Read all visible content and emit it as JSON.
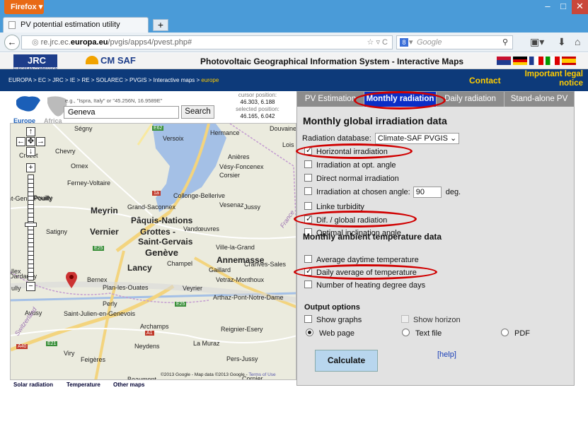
{
  "browser": {
    "firefox_label": "Firefox",
    "tab_title": "PV potential estimation utility",
    "new_tab": "+",
    "url_prefix": "re.jrc.ec.",
    "url_domain": "europa.eu",
    "url_rest": "/pvgis/apps4/pvest.php#",
    "search_engine_label": "8",
    "search_placeholder": "Google"
  },
  "site": {
    "jrc_label": "JRC",
    "jrc_sub": "EUROPEAN COMMISSION",
    "cmsaf_label": "CM SAF",
    "title": "Photovoltaic Geographical Information System - Interactive Maps",
    "breadcrumb": "EUROPA > EC > JRC > IE > RE > SOLAREC > PVGIS > Interactive maps > ",
    "breadcrumb_current": "europe",
    "contact": "Contact",
    "legal_1": "Important legal",
    "legal_2": "notice"
  },
  "search": {
    "hint": "e.g., \"Ispra, Italy\" or \"45.256N, 16.9589E\"",
    "value": "Geneva",
    "button": "Search",
    "europe": "Europe",
    "africa": "Africa",
    "cursor_label": "cursor position:",
    "cursor_value": "46.303, 6.188",
    "selected_label": "selected position:",
    "selected_value": "46.165, 6.042"
  },
  "map": {
    "labels": [
      "Ségny",
      "Versoix",
      "Hermance",
      "Douvaine",
      "Chevry",
      "Crozet",
      "Anières",
      "Lois",
      "Ornex",
      "Vésy-Foncenex",
      "Corsier",
      "Ferney-Voltaire",
      "Pouilly",
      "Collonge-Bellerive",
      "int-Genis-Pouilly",
      "Vesenaz",
      "Jussy",
      "Meyrin",
      "Grand-Saconnex",
      "Pâquis-Nations",
      "Satigny",
      "Vernier",
      "Grottes -",
      "Vandœuvres",
      "Saint-Gervais",
      "Ville-la-Grand",
      "Genève",
      "Annemasse",
      "Dardagny",
      "Champel",
      "Cranves-Sales",
      "Lancy",
      "Gaillard",
      "allex",
      "Bernex",
      "Vetraz-Monthoux",
      "Plan-les-Ouates",
      "Veyrier",
      "ully",
      "Perly",
      "Arthaz-Pont-Notre-Dame",
      "Avusy",
      "Saint-Julien-en-Genevois",
      "Archamps",
      "Reignier-Esery",
      "Neydens",
      "La Muraz",
      "Viry",
      "Feigères",
      "Pers-Jussy",
      "Beaumont",
      "Cornier",
      "Switzerland",
      "France"
    ],
    "roads": [
      "E62",
      "E25",
      "1a",
      "A1",
      "A40",
      "E21",
      "E25"
    ],
    "copyright": "©2013 Google - Map data ©2013 Google - ",
    "terms": "Terms of Use",
    "tabs": [
      "Solar radiation",
      "Temperature",
      "Other maps"
    ]
  },
  "panel": {
    "tabs": [
      "PV Estimation",
      "Monthly radiation",
      "Daily radiation",
      "Stand-alone PV"
    ],
    "heading": "Monthly global irradiation data",
    "db_label": "Radiation database:",
    "db_value": "Climate-SAF PVGIS",
    "options": [
      {
        "label": "Horizontal irradiation",
        "checked": true
      },
      {
        "label": "Irradiation at opt. angle",
        "checked": false
      },
      {
        "label": "Direct normal irradiation",
        "checked": false
      },
      {
        "label": "Irradiation at chosen angle:",
        "checked": false
      },
      {
        "label": "Linke turbidity",
        "checked": false
      },
      {
        "label": "Dif. / global radiation",
        "checked": true
      },
      {
        "label": "Optimal inclination angle",
        "checked": false
      }
    ],
    "angle_value": "90",
    "angle_unit": "deg.",
    "temp_heading": "Monthly ambient temperature data",
    "temp_options": [
      {
        "label": "Average daytime temperature",
        "checked": false
      },
      {
        "label": "Daily average of temperature",
        "checked": true
      },
      {
        "label": "Number of heating degree days",
        "checked": false
      }
    ],
    "output_heading": "Output options",
    "show_graphs": "Show graphs",
    "show_horizon": "Show horizon",
    "web_page": "Web page",
    "text_file": "Text file",
    "pdf": "PDF",
    "calculate": "Calculate",
    "help": "[help]"
  },
  "colors": {
    "highlight": "#d00000",
    "active_tab": "#0a2ec7",
    "breadcrumb_bg": "#0d3a7a",
    "accent_yellow": "#ffcc00"
  }
}
